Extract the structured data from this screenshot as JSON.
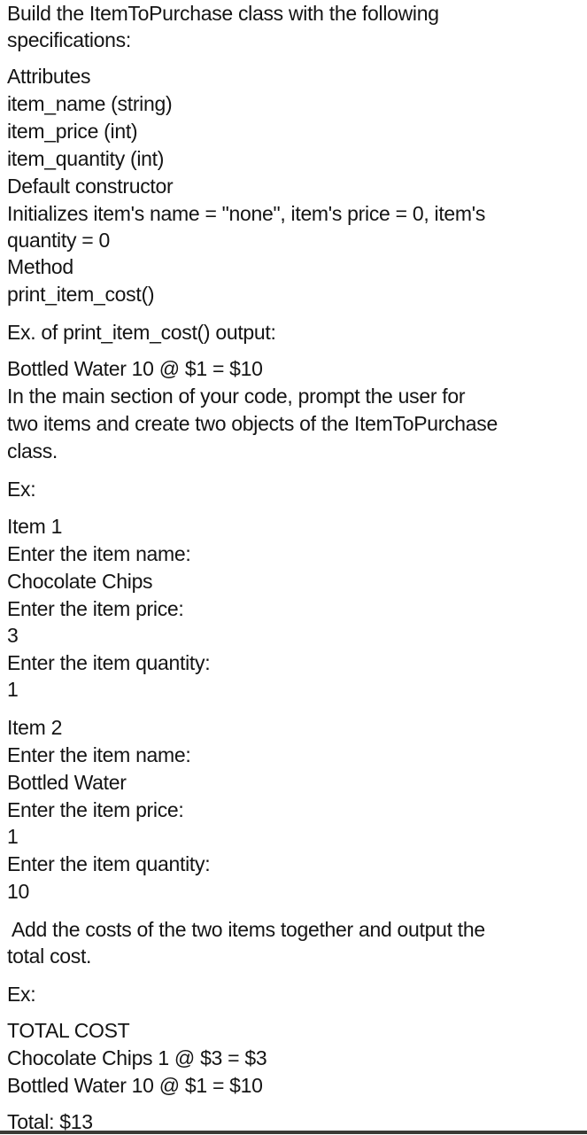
{
  "intro": {
    "heading_line1": "Build the ItemToPurchase class with the following",
    "heading_line2": "specifications:"
  },
  "attributes": {
    "label": "Attributes",
    "items": [
      "item_name (string)",
      "item_price (int)",
      "item_quantity (int)"
    ]
  },
  "constructor": {
    "label": "Default constructor",
    "desc_line1": "Initializes item's name = \"none\", item's price = 0, item's",
    "desc_line2": "quantity = 0"
  },
  "method": {
    "label": "Method",
    "name": "print_item_cost()"
  },
  "example_output": {
    "label": "Ex. of print_item_cost() output:",
    "line": "Bottled Water 10 @ $1 = $10"
  },
  "main_instructions": {
    "line1": "In the main section of your code, prompt the user for",
    "line2": "two items and create two objects of the ItemToPurchase",
    "line3": "class."
  },
  "example1_label": "Ex:",
  "item1": {
    "title": "Item 1",
    "name_prompt": "Enter the item name:",
    "name_value": "Chocolate Chips",
    "price_prompt": "Enter the item price:",
    "price_value": "3",
    "quantity_prompt": "Enter the item quantity:",
    "quantity_value": "1"
  },
  "item2": {
    "title": "Item 2",
    "name_prompt": "Enter the item name:",
    "name_value": "Bottled Water",
    "price_prompt": "Enter the item price:",
    "price_value": "1",
    "quantity_prompt": "Enter the item quantity:",
    "quantity_value": "10"
  },
  "total_instructions": {
    "line1": "Add the costs of the two items together and output the",
    "line2": "total cost."
  },
  "example2_label": "Ex:",
  "total_output": {
    "header": "TOTAL COST",
    "lines": [
      "Chocolate Chips 1 @ $3 = $3",
      "Bottled Water 10 @ $1 = $10"
    ],
    "total": "Total: $13"
  }
}
